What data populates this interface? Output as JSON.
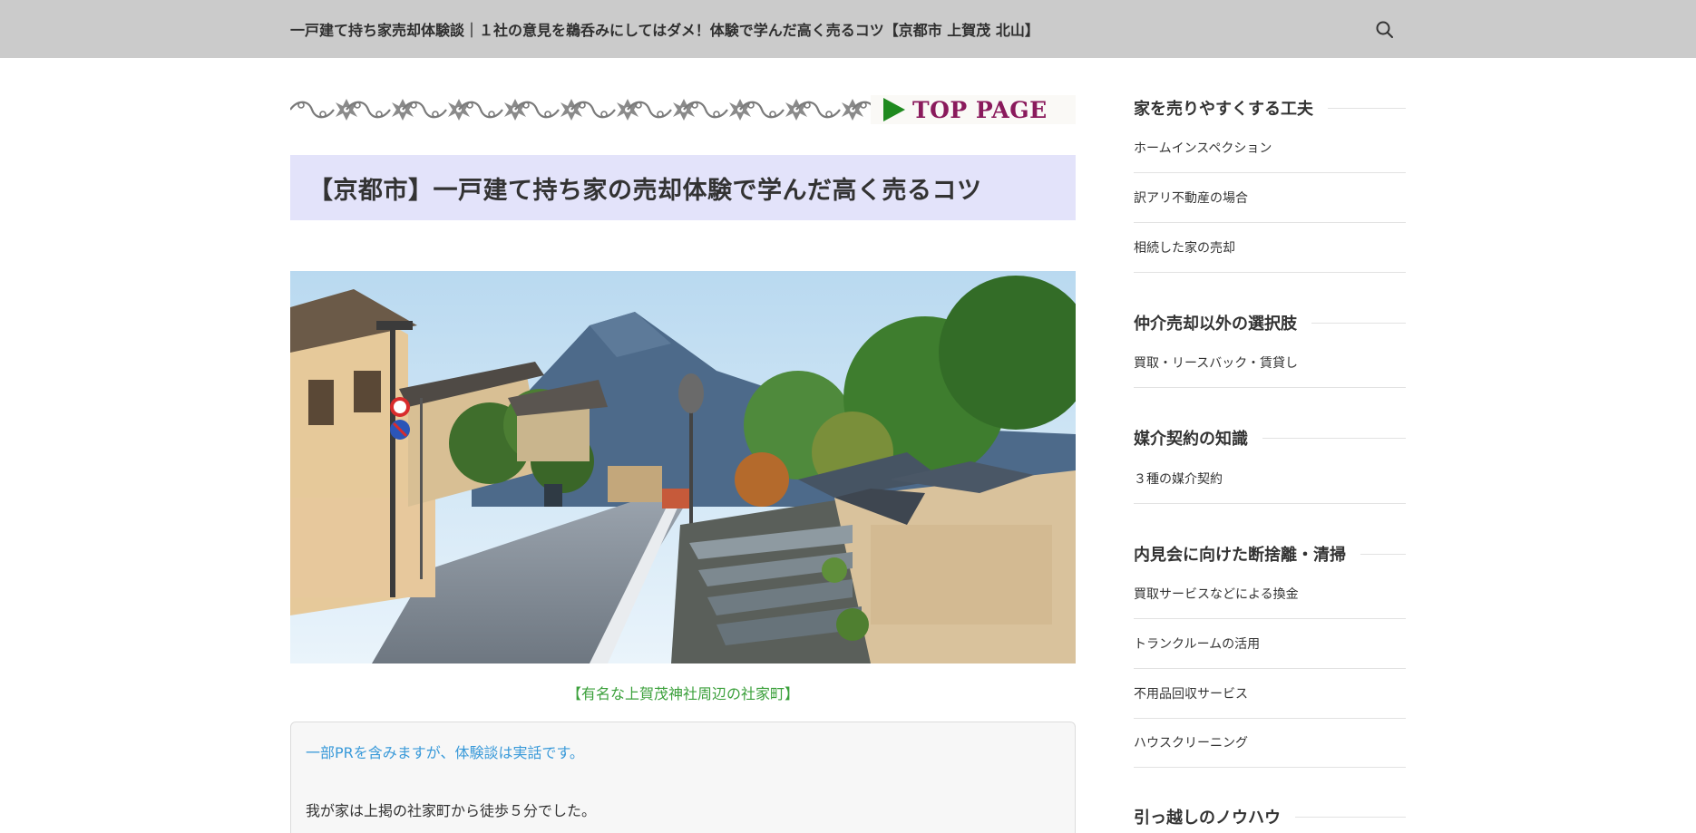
{
  "header": {
    "site_title": "一戸建て持ち家売却体験談｜１社の意見を鵜呑みにしてはダメ！体験で学んだ高く売るコツ【京都市 上賀茂 北山】",
    "search_icon": "search-icon"
  },
  "banner": {
    "top_page_label": "TOP PAGE"
  },
  "article": {
    "title": "【京都市】一戸建て持ち家の売却体験で学んだ高く売るコツ",
    "image_caption": "【有名な上賀茂神社周辺の社家町】",
    "notice_pr": "一部PRを含みますが、体験談は実話です。",
    "intro_text": "我が家は上掲の社家町から徒歩５分でした。"
  },
  "sidebar": {
    "sections": [
      {
        "heading": "家を売りやすくする工夫",
        "items": [
          "ホームインスペクション",
          "訳アリ不動産の場合",
          "相続した家の売却"
        ]
      },
      {
        "heading": "仲介売却以外の選択肢",
        "items": [
          "買取・リースバック・賃貸し"
        ]
      },
      {
        "heading": "媒介契約の知識",
        "items": [
          "３種の媒介契約"
        ]
      },
      {
        "heading": "内見会に向けた断捨離・清掃",
        "items": [
          "買取サービスなどによる換金",
          "トランクルームの活用",
          "不用品回収サービス",
          "ハウスクリーニング"
        ]
      },
      {
        "heading": "引っ越しのノウハウ",
        "items": []
      }
    ]
  },
  "colors": {
    "header_bg": "#cbcbcb",
    "title_box_bg": "#e3e3fa",
    "caption_green": "#3ba03b",
    "pr_blue": "#3a9ad9",
    "top_page_text": "#8a1a5c"
  }
}
